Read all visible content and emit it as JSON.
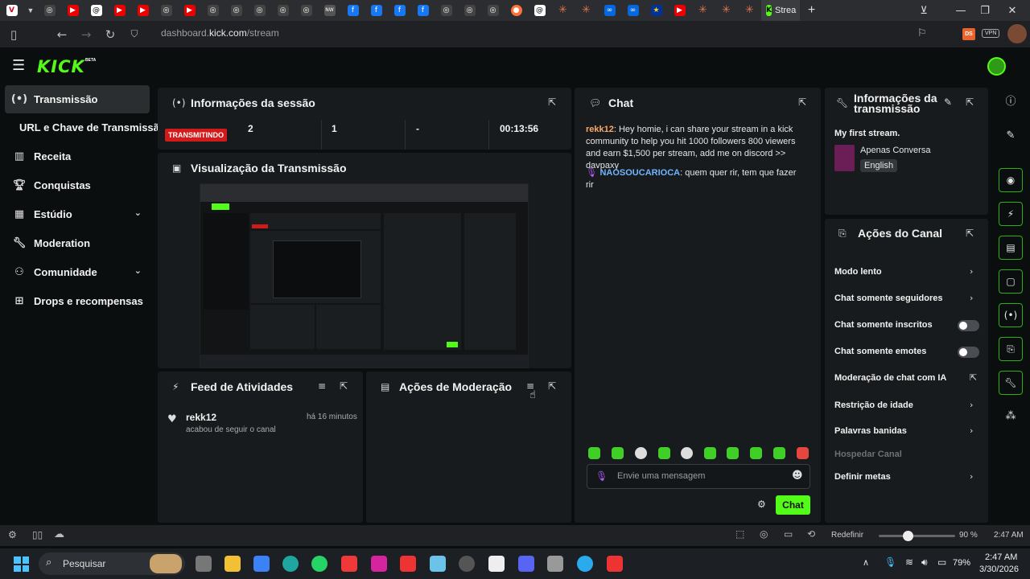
{
  "browser": {
    "active_tab_title": "Strea",
    "url_prefix": "dashboard.",
    "url_domain": "kick.com",
    "url_path": "/stream",
    "vpn_label": "VPN",
    "ds_label": "DS"
  },
  "kick": {
    "logo": "KICK",
    "beta": "BETA"
  },
  "sidebar": {
    "items": [
      {
        "label": "Transmissão",
        "icon": "broadcast-icon"
      },
      {
        "label": "URL e Chave de Transmissão",
        "icon": ""
      },
      {
        "label": "Receita",
        "icon": "chart-icon"
      },
      {
        "label": "Conquistas",
        "icon": "trophy-icon"
      },
      {
        "label": "Estúdio",
        "icon": "grid-icon"
      },
      {
        "label": "Moderation",
        "icon": "wrench-icon"
      },
      {
        "label": "Comunidade",
        "icon": "people-icon"
      },
      {
        "label": "Drops e recompensas",
        "icon": "drops-icon"
      }
    ]
  },
  "session": {
    "title": "Informações da sessão",
    "status": "TRANSMITINDO",
    "viewers": "2",
    "followers": "1",
    "subs": "-",
    "duration": "00:13:56"
  },
  "preview": {
    "title": "Visualização da Transmissão"
  },
  "activity": {
    "title": "Feed de Atividades",
    "items": [
      {
        "user": "rekk12",
        "action": "acabou de seguir o canal",
        "time": "há 16 minutos"
      }
    ]
  },
  "modactions": {
    "title": "Ações de Moderação"
  },
  "chat": {
    "title": "Chat",
    "messages": [
      {
        "user": "rekk12",
        "text": ": Hey homie, i can share your stream in a kick community to help you hit 1000 followers 800 viewers and earn $1,500 per stream, add me on discord >> davpaxy"
      },
      {
        "user": "NAOSOUCARIOCA",
        "text": ": quem quer rir, tem que fazer rir"
      }
    ],
    "input_placeholder": "Envie uma mensagem",
    "send_label": "Chat"
  },
  "stream_info": {
    "title_line1": "Informações da",
    "title_line2": "transmissão",
    "stream_title": "My first stream.",
    "category": "Apenas Conversa",
    "language": "English"
  },
  "channel_actions": {
    "title": "Ações do Canal",
    "items": [
      {
        "label": "Modo lento",
        "control": "chevron"
      },
      {
        "label": "Chat somente seguidores",
        "control": "chevron"
      },
      {
        "label": "Chat somente inscritos",
        "control": "toggle"
      },
      {
        "label": "Chat somente emotes",
        "control": "toggle"
      },
      {
        "label": "Moderação de chat com IA",
        "control": "popout"
      },
      {
        "label": "Restrição de idade",
        "control": "chevron"
      },
      {
        "label": "Palavras banidas",
        "control": "chevron"
      },
      {
        "label": "Hospedar Canal",
        "control": "disabled"
      },
      {
        "label": "Definir metas",
        "control": "chevron"
      }
    ]
  },
  "statusbar": {
    "reset_label": "Redefinir",
    "zoom": "90 %",
    "zoom_value": 0.9,
    "time": "2:47 AM"
  },
  "taskbar": {
    "search_placeholder": "Pesquisar",
    "battery": "79%",
    "time": "2:47 AM",
    "date": "3/30/2026"
  },
  "colors": {
    "kick_green": "#53fc18",
    "live_red": "#d31a1a",
    "panel_bg": "#181b1d",
    "page_bg": "#0b0e0f"
  }
}
